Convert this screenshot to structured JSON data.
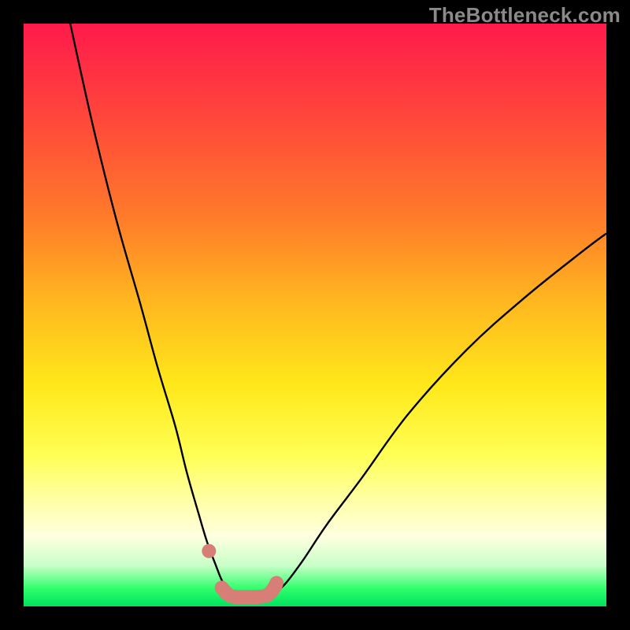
{
  "watermark": "TheBottleneck.com",
  "chart_data": {
    "type": "line",
    "title": "",
    "xlabel": "",
    "ylabel": "",
    "xlim": [
      0,
      100
    ],
    "ylim": [
      0,
      100
    ],
    "grid": false,
    "legend": false,
    "series": [
      {
        "name": "left-curve",
        "x": [
          8,
          12,
          16,
          20,
          23,
          26,
          28,
          30,
          31.5,
          33,
          34,
          35,
          35.8,
          36.2
        ],
        "y": [
          100,
          82,
          66,
          52,
          41,
          31,
          23,
          16,
          11,
          7,
          4.5,
          3,
          2.2,
          2
        ]
      },
      {
        "name": "right-curve",
        "x": [
          42,
          43,
          45,
          48,
          52,
          58,
          66,
          76,
          86,
          96,
          100
        ],
        "y": [
          2,
          2.3,
          4,
          8,
          14,
          22,
          33,
          44,
          53,
          61,
          64
        ]
      },
      {
        "name": "valley-marker",
        "x": [
          34,
          34.8,
          35.5,
          36.5,
          38,
          40,
          41.5,
          42.3,
          43,
          43.4
        ],
        "y": [
          3.2,
          2.3,
          1.8,
          1.6,
          1.6,
          1.6,
          1.8,
          2.3,
          3.2,
          4
        ]
      },
      {
        "name": "left-dot",
        "x": [
          31.8
        ],
        "y": [
          9.5
        ]
      }
    ],
    "colors": {
      "curve": "#000000",
      "marker": "#d77e76"
    }
  }
}
